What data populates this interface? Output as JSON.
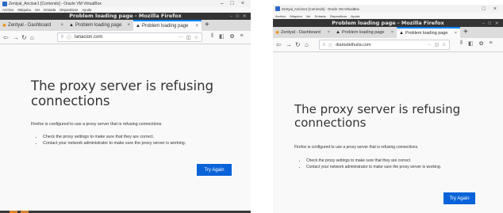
{
  "screens": [
    {
      "vm_title": "Zentyal_Ancizar1 [Corriendo] - Oracle VM VirtualBox",
      "vm_menu": [
        "Archivo",
        "Máquina",
        "Ver",
        "Entrada",
        "Dispositivos",
        "Ayuda"
      ],
      "window_title": "Problem loading page - Mozilla Firefox",
      "tabs": [
        {
          "label": "Zentyal - Dashboard",
          "icon": "zentyal-icon",
          "active": false
        },
        {
          "label": "Problem loading page",
          "icon": "warning-icon",
          "active": false
        },
        {
          "label": "Problem loading page",
          "icon": "warning-icon",
          "active": true
        }
      ],
      "url": "lanacion.com",
      "error_title": "The proxy server is refusing connections",
      "error_description": "Firefox is configured to use a proxy server that is refusing connections.",
      "suggestions": [
        "Check the proxy settings to make sure that they are correct.",
        "Contact your network administrator to make sure the proxy server is working."
      ],
      "try_again": "Try Again"
    },
    {
      "vm_title": "Zentyal_Ancizar1 [Corriendo] - Oracle VM VirtualBox",
      "vm_menu": [
        "Archivo",
        "Máquina",
        "Ver",
        "Entrada",
        "Dispositivos",
        "Ayuda"
      ],
      "window_title": "Problem loading page - Mozilla Firefox",
      "tabs": [
        {
          "label": "Zentyal - Dashboard",
          "icon": "zentyal-icon",
          "active": false
        },
        {
          "label": "Problem loading page",
          "icon": "warning-icon",
          "active": false
        },
        {
          "label": "Problem loading page",
          "icon": "warning-icon",
          "active": true
        }
      ],
      "url": "diariodelhuila.com",
      "error_title": "The proxy server is refusing connections",
      "error_description": "Firefox is configured to use a proxy server that is refusing connections.",
      "suggestions": [
        "Check the proxy settings to make sure that they are correct.",
        "Contact your network administrator to make sure the proxy server is working."
      ],
      "try_again": "Try Again"
    }
  ],
  "colors": {
    "tab_accent": "#0a84ff",
    "try_again_button": "#0a63d8",
    "firefox_titlebar": "#343434",
    "page_background": "#f9f9fa"
  }
}
